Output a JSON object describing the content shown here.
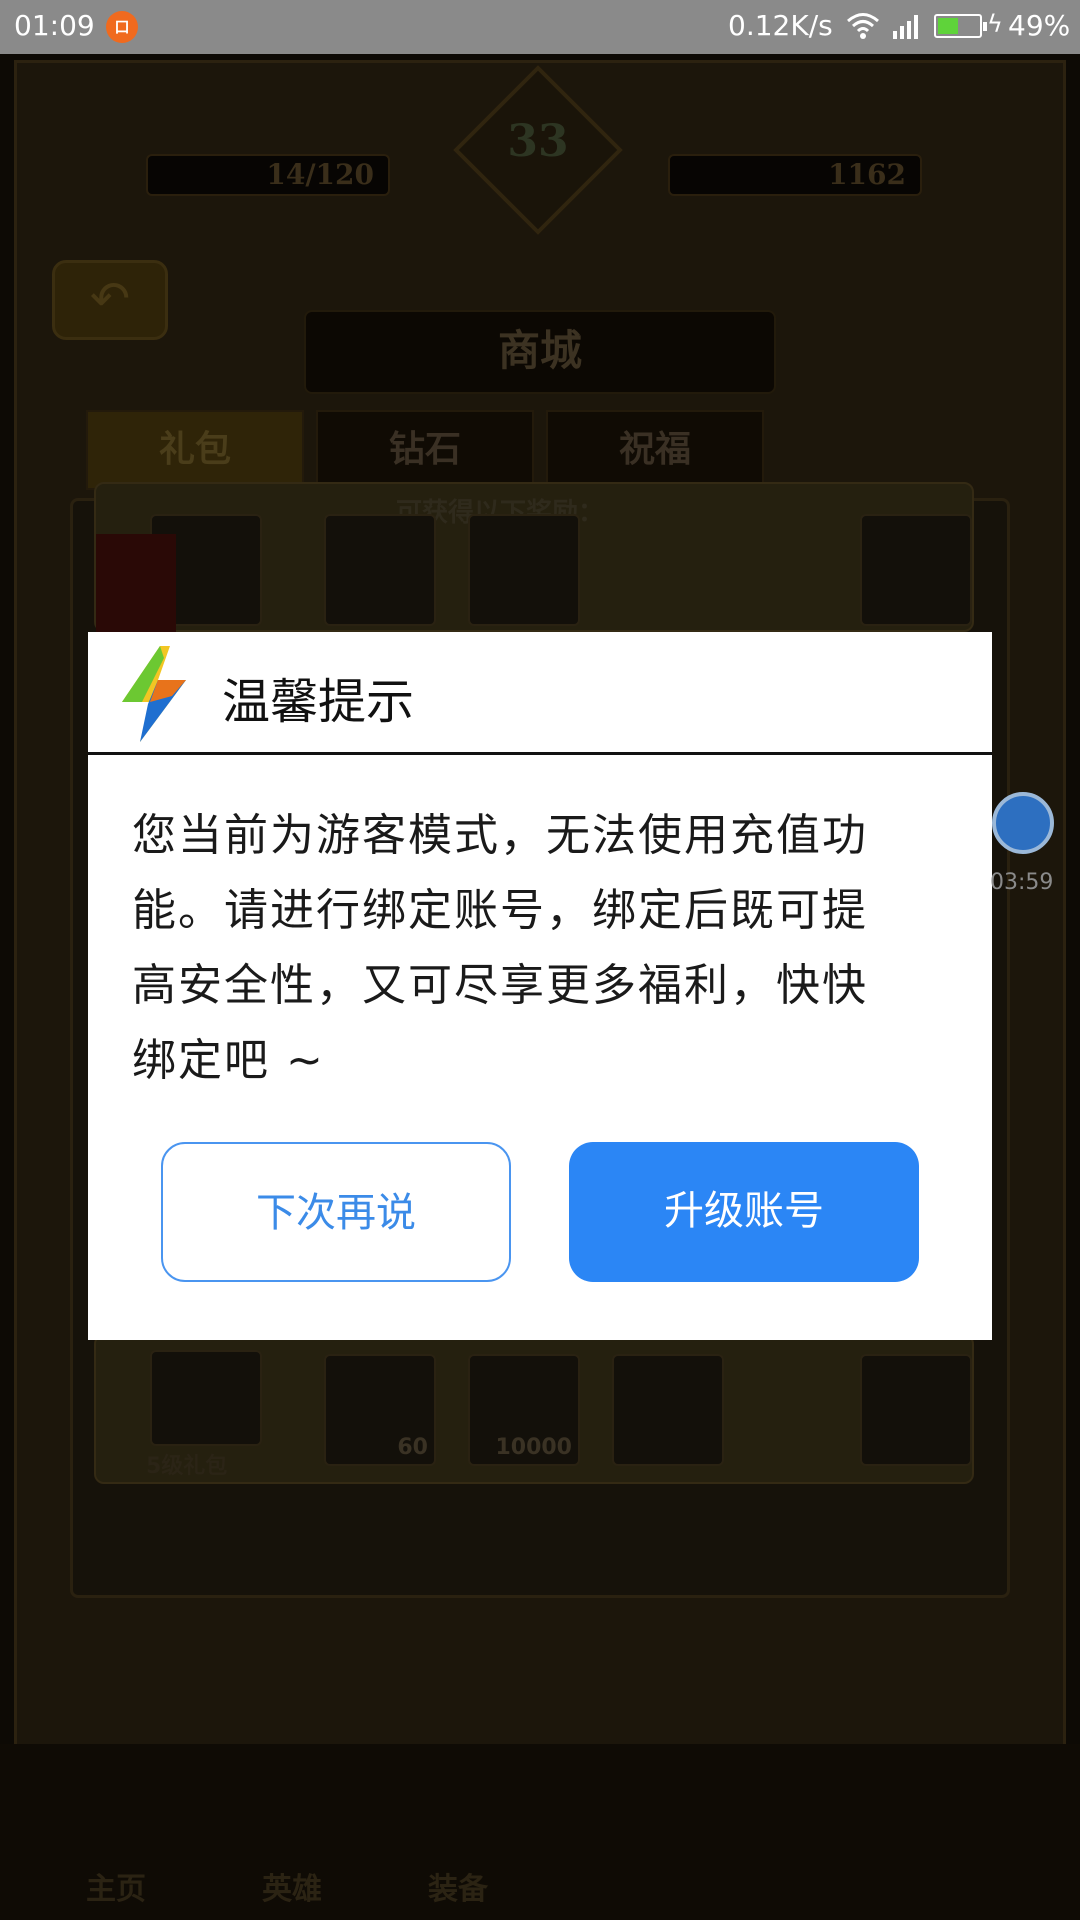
{
  "status_bar": {
    "time": "01:09",
    "notification_glyph": "口",
    "network_speed": "0.12K/s",
    "battery_percent": "49%",
    "battery_level": 0.49
  },
  "game": {
    "resource_left": "14/120",
    "resource_right": "1162",
    "level_emblem": "33",
    "shop_title": "商城",
    "tabs": [
      "礼包",
      "钻石",
      "祝福"
    ],
    "reward_label": "可获得以下奖励：",
    "pack_label": "5级礼包",
    "item_values": [
      "60",
      "10000"
    ],
    "nav_items": [
      "主页",
      "英雄",
      "装备"
    ]
  },
  "dialog": {
    "title": "温馨提示",
    "message_lines": [
      "您当前为游客模式，无法使用充值功",
      "能。请进行绑定账号，绑定后既可提",
      "高安全性，又可尽享更多福利，快快",
      "绑定吧 ~"
    ],
    "cancel_label": "下次再说",
    "confirm_label": "升级账号",
    "accent_color": "#2b86f5"
  },
  "recorder": {
    "elapsed": "03:59"
  }
}
